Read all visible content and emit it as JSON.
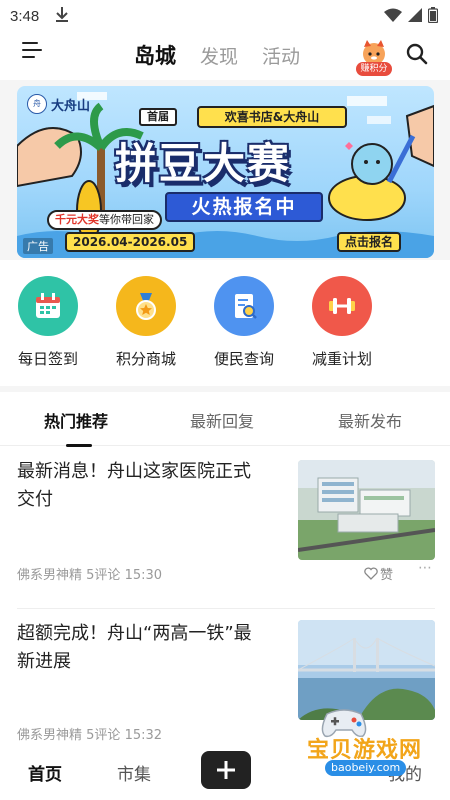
{
  "status_bar": {
    "time": "3:48"
  },
  "header": {
    "tabs": [
      {
        "label": "岛城",
        "active": true
      },
      {
        "label": "发现",
        "active": false
      },
      {
        "label": "活动",
        "active": false
      }
    ],
    "points_label": "赚积分"
  },
  "banner": {
    "logo_text": "大舟山",
    "cobrand": "欢喜书店&大舟山",
    "first_tag": "首届",
    "title": "拼豆大赛",
    "cta": "火热报名中",
    "prize_text": "千元大奖",
    "prize_suffix": "等你带回家",
    "ad_label": "广告",
    "date_range": "2026.04-2026.05",
    "signup": "点击报名"
  },
  "quick_actions": [
    {
      "label": "每日签到",
      "icon": "calendar-icon",
      "color": "#2fc3a6"
    },
    {
      "label": "积分商城",
      "icon": "medal-icon",
      "color": "#f5b71c"
    },
    {
      "label": "便民查询",
      "icon": "document-search-icon",
      "color": "#4f93f0"
    },
    {
      "label": "减重计划",
      "icon": "dumbbell-icon",
      "color": "#f0584a"
    }
  ],
  "feed_tabs": [
    {
      "label": "热门推荐",
      "active": true
    },
    {
      "label": "最新回复",
      "active": false
    },
    {
      "label": "最新发布",
      "active": false
    }
  ],
  "articles": [
    {
      "title": "最新消息！舟山这家医院正式交付",
      "author": "佛系男神精",
      "comments": "5评论",
      "time": "15:30",
      "like_label": "赞",
      "thumb": "hospital-aerial-photo"
    },
    {
      "title": "超额完成！舟山“两高一铁”最新进展",
      "author": "佛系男神精",
      "comments": "5评论",
      "time": "15:32",
      "like_label": "赞",
      "thumb": "bridge-aerial-photo"
    }
  ],
  "bottom_nav": [
    {
      "label": "首页",
      "active": true
    },
    {
      "label": "市集",
      "active": false
    },
    {
      "label": "我的",
      "active": false
    }
  ],
  "watermark": {
    "text": "宝贝游戏网",
    "url": "baobeiy.com"
  }
}
